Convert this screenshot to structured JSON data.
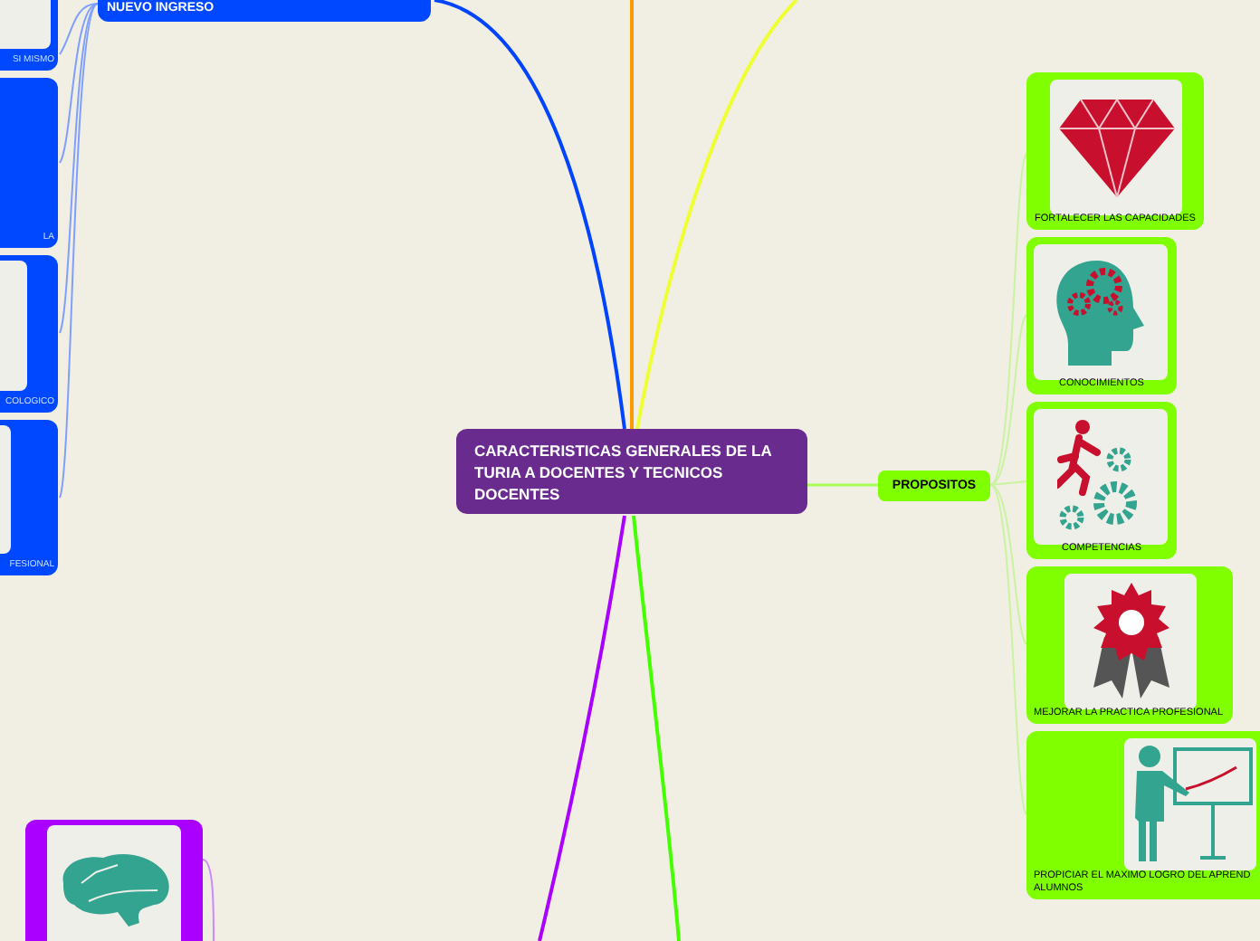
{
  "central_topic": "CARACTERISTICAS GENERALES DE LA TURIA A DOCENTES Y TECNICOS DOCENTES",
  "top_topic": "NUEVO INGRESO",
  "left_cards": [
    {
      "label": "SI MISMO"
    },
    {
      "label": "LA"
    },
    {
      "label": "COLOGICO"
    },
    {
      "label": "FESIONAL"
    }
  ],
  "propositos": {
    "label": "PROPOSITOS",
    "cards": [
      {
        "label_lines": [
          "FORTALECER LAS CAPACIDADES"
        ]
      },
      {
        "label_lines": [
          "CONOCIMIENTOS"
        ]
      },
      {
        "label_lines": [
          "COMPETENCIAS"
        ]
      },
      {
        "label_lines": [
          "MEJORAR LA PRACTICA PROFESIONAL"
        ]
      },
      {
        "label_lines": [
          "PROPICIAR EL MAXIMO LOGRO DEL APREND",
          "ALUMNOS"
        ]
      }
    ]
  }
}
